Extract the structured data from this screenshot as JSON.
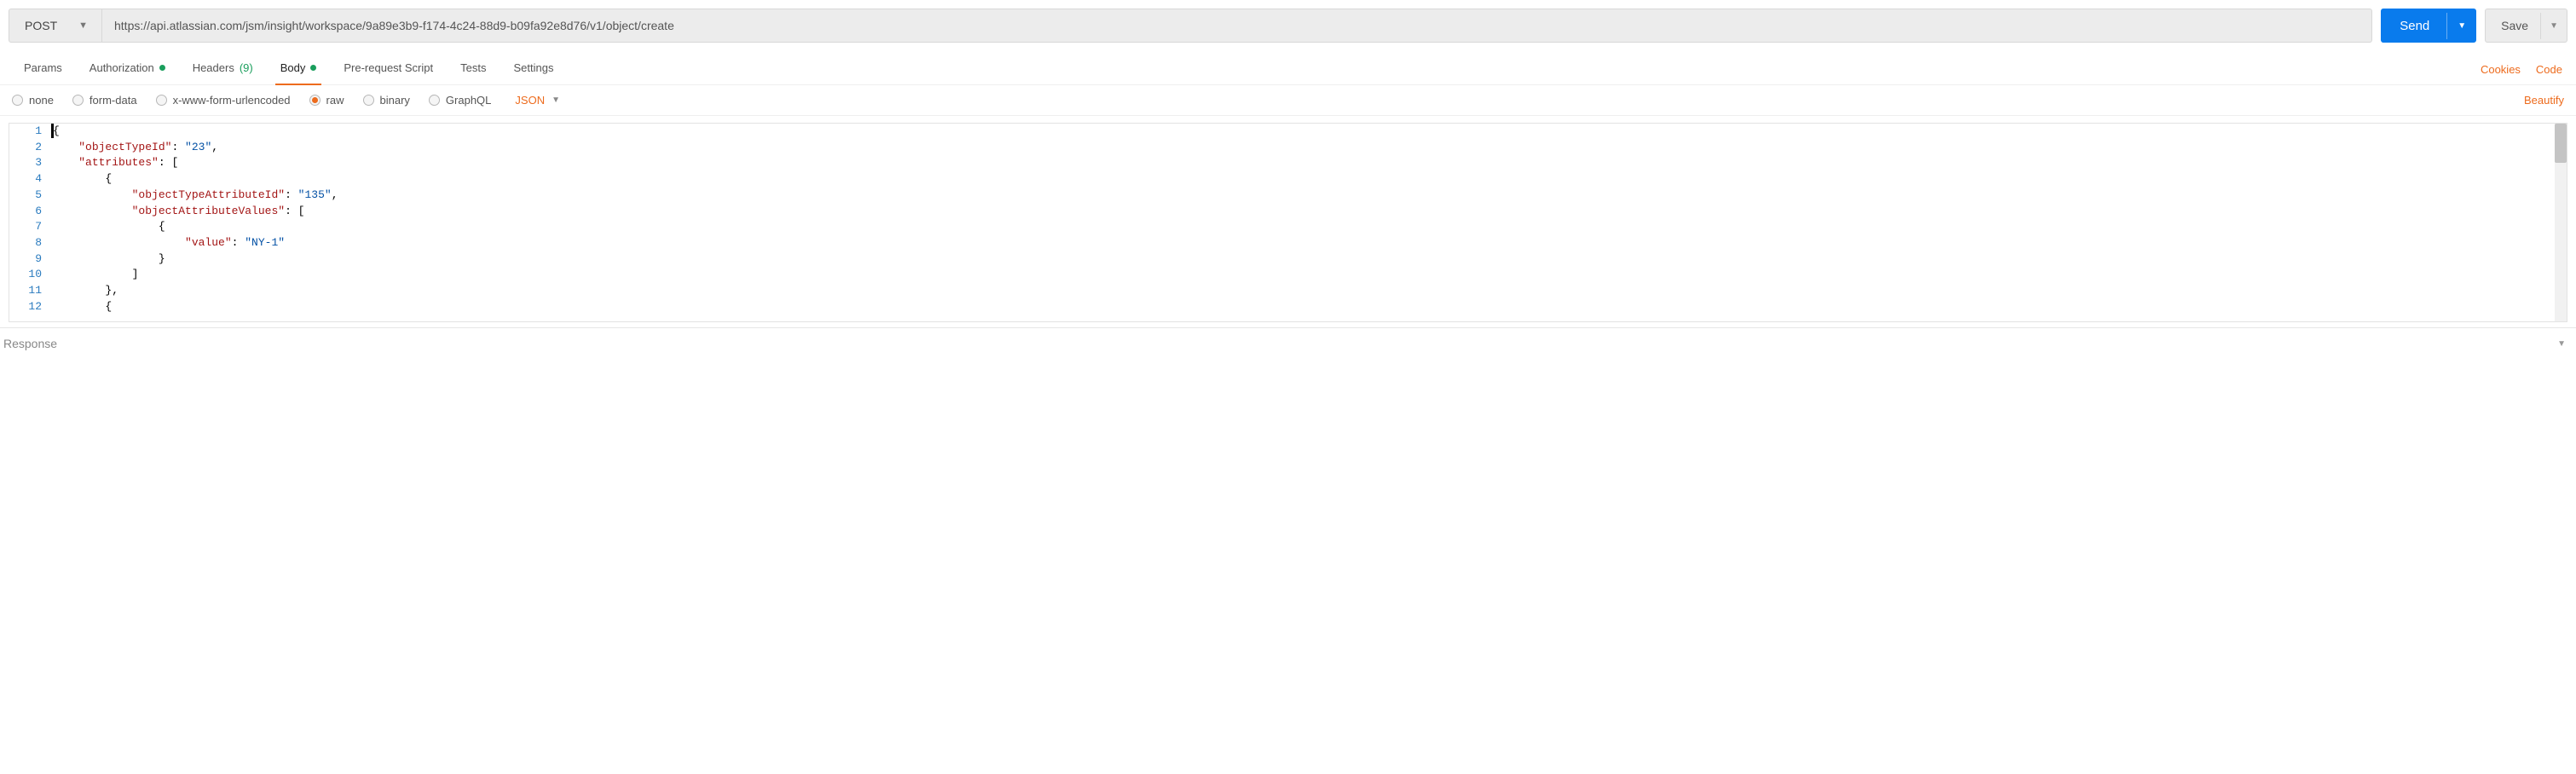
{
  "request": {
    "method": "POST",
    "url": "https://api.atlassian.com/jsm/insight/workspace/9a89e3b9-f174-4c24-88d9-b09fa92e8d76/v1/object/create"
  },
  "buttons": {
    "send": "Send",
    "save": "Save"
  },
  "tabs": {
    "params": "Params",
    "authorization": "Authorization",
    "headers": "Headers",
    "headers_count": "(9)",
    "body": "Body",
    "prerequest": "Pre-request Script",
    "tests": "Tests",
    "settings": "Settings"
  },
  "right_links": {
    "cookies": "Cookies",
    "code": "Code"
  },
  "body_types": {
    "none": "none",
    "form_data": "form-data",
    "xwww": "x-www-form-urlencoded",
    "raw": "raw",
    "binary": "binary",
    "graphql": "GraphQL",
    "raw_lang": "JSON"
  },
  "beautify_label": "Beautify",
  "editor": {
    "lines": [
      [
        {
          "t": "cursor"
        },
        {
          "t": "punc",
          "v": "{"
        }
      ],
      [
        {
          "t": "indent",
          "n": 4
        },
        {
          "t": "key",
          "v": "\"objectTypeId\""
        },
        {
          "t": "punc",
          "v": ": "
        },
        {
          "t": "str",
          "v": "\"23\""
        },
        {
          "t": "punc",
          "v": ","
        }
      ],
      [
        {
          "t": "indent",
          "n": 4
        },
        {
          "t": "key",
          "v": "\"attributes\""
        },
        {
          "t": "punc",
          "v": ": ["
        }
      ],
      [
        {
          "t": "indent",
          "n": 8
        },
        {
          "t": "punc",
          "v": "{"
        }
      ],
      [
        {
          "t": "indent",
          "n": 12
        },
        {
          "t": "key",
          "v": "\"objectTypeAttributeId\""
        },
        {
          "t": "punc",
          "v": ": "
        },
        {
          "t": "str",
          "v": "\"135\""
        },
        {
          "t": "punc",
          "v": ","
        }
      ],
      [
        {
          "t": "indent",
          "n": 12
        },
        {
          "t": "key",
          "v": "\"objectAttributeValues\""
        },
        {
          "t": "punc",
          "v": ": ["
        }
      ],
      [
        {
          "t": "indent",
          "n": 16
        },
        {
          "t": "punc",
          "v": "{"
        }
      ],
      [
        {
          "t": "indent",
          "n": 20
        },
        {
          "t": "key",
          "v": "\"value\""
        },
        {
          "t": "punc",
          "v": ": "
        },
        {
          "t": "str",
          "v": "\"NY-1\""
        }
      ],
      [
        {
          "t": "indent",
          "n": 16
        },
        {
          "t": "punc",
          "v": "}"
        }
      ],
      [
        {
          "t": "indent",
          "n": 12
        },
        {
          "t": "punc",
          "v": "]"
        }
      ],
      [
        {
          "t": "indent",
          "n": 8
        },
        {
          "t": "punc",
          "v": "},"
        }
      ],
      [
        {
          "t": "indent",
          "n": 8
        },
        {
          "t": "punc",
          "v": "{"
        }
      ]
    ]
  },
  "response_label": "Response"
}
